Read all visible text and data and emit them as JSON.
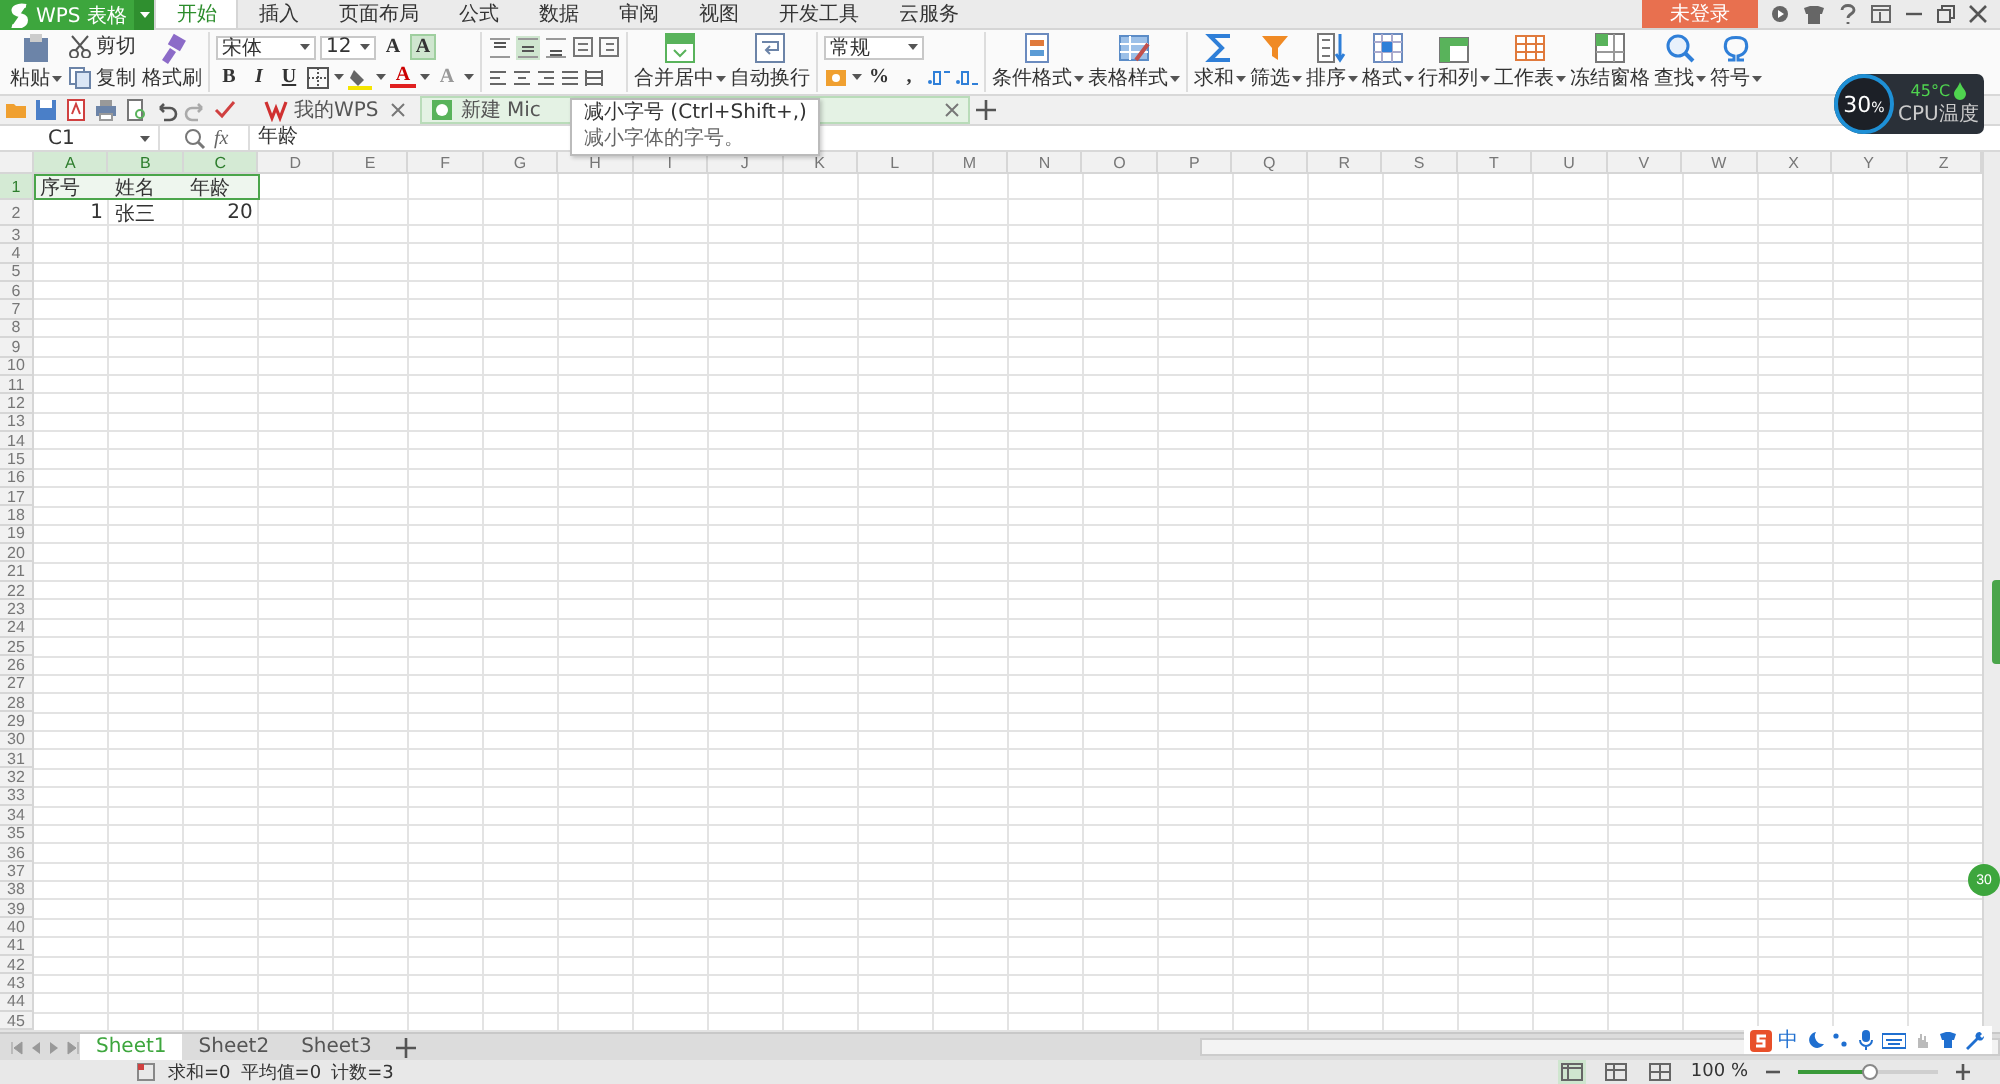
{
  "app_button": {
    "label": "WPS 表格"
  },
  "menu_tabs": [
    {
      "label": "开始",
      "selected": true
    },
    {
      "label": "插入",
      "selected": false
    },
    {
      "label": "页面布局",
      "selected": false
    },
    {
      "label": "公式",
      "selected": false
    },
    {
      "label": "数据",
      "selected": false
    },
    {
      "label": "审阅",
      "selected": false
    },
    {
      "label": "视图",
      "selected": false
    },
    {
      "label": "开发工具",
      "selected": false
    },
    {
      "label": "云服务",
      "selected": false
    }
  ],
  "login_button": "未登录",
  "ribbon": {
    "clipboard": {
      "paste": "粘贴",
      "cut": "剪切",
      "copy": "复制",
      "format_painter": "格式刷"
    },
    "font": {
      "name": "宋体",
      "size": "12",
      "grow": {
        "label": "A",
        "hovered": false
      },
      "shrink": {
        "label": "A",
        "hovered": true
      },
      "bold": "B",
      "italic": "I",
      "underline": "U",
      "font_color": "A",
      "clear": "A"
    },
    "vertical_align": [
      {
        "selected": false
      },
      {
        "selected": true
      },
      {
        "selected": false
      }
    ],
    "merge": "合并居中",
    "wrap": "自动换行",
    "number": {
      "format": "常规",
      "percent": "%",
      "comma": ","
    },
    "tools": [
      {
        "label": "条件格式",
        "dropdown": true,
        "kind": "cond"
      },
      {
        "label": "表格样式",
        "dropdown": true,
        "kind": "style"
      },
      {
        "label": "求和",
        "dropdown": true,
        "kind": "sum"
      },
      {
        "label": "筛选",
        "dropdown": true,
        "kind": "filter"
      },
      {
        "label": "排序",
        "dropdown": true,
        "kind": "sort"
      },
      {
        "label": "格式",
        "dropdown": true,
        "kind": "format"
      },
      {
        "label": "行和列",
        "dropdown": true,
        "kind": "rowcol"
      },
      {
        "label": "工作表",
        "dropdown": true,
        "kind": "sheet"
      },
      {
        "label": "冻结窗格",
        "dropdown": false,
        "kind": "freeze"
      },
      {
        "label": "查找",
        "dropdown": true,
        "kind": "find"
      },
      {
        "label": "符号",
        "dropdown": true,
        "kind": "symbol"
      }
    ]
  },
  "doc_tabs": [
    {
      "label": "我的WPS",
      "selected": false
    },
    {
      "label": "新建 Mic",
      "selected": true
    }
  ],
  "tooltip": {
    "title": "减小字号 (Ctrl+Shift+,)",
    "body": "减小字体的字号。"
  },
  "cpu_widget": {
    "load": "30",
    "unit": "%",
    "temperature": "45°C",
    "caption": "CPU温度"
  },
  "formula_bar": {
    "name_box": "C1",
    "function_label": "fx",
    "value": "年龄"
  },
  "columns": [
    {
      "label": "A",
      "selected": true
    },
    {
      "label": "B",
      "selected": true
    },
    {
      "label": "C",
      "selected": true
    },
    {
      "label": "D",
      "selected": false
    },
    {
      "label": "E",
      "selected": false
    },
    {
      "label": "F",
      "selected": false
    },
    {
      "label": "G",
      "selected": false
    },
    {
      "label": "H",
      "selected": false
    },
    {
      "label": "I",
      "selected": false
    },
    {
      "label": "J",
      "selected": false
    },
    {
      "label": "K",
      "selected": false
    },
    {
      "label": "L",
      "selected": false
    },
    {
      "label": "M",
      "selected": false
    },
    {
      "label": "N",
      "selected": false
    },
    {
      "label": "O",
      "selected": false
    },
    {
      "label": "P",
      "selected": false
    },
    {
      "label": "Q",
      "selected": false
    },
    {
      "label": "R",
      "selected": false
    },
    {
      "label": "S",
      "selected": false
    },
    {
      "label": "T",
      "selected": false
    },
    {
      "label": "U",
      "selected": false
    },
    {
      "label": "V",
      "selected": false
    },
    {
      "label": "W",
      "selected": false
    },
    {
      "label": "X",
      "selected": false
    },
    {
      "label": "Y",
      "selected": false
    },
    {
      "label": "Z",
      "selected": false
    }
  ],
  "rows": [
    {
      "label": "1",
      "selected": true,
      "cells": [
        {
          "text": "序号",
          "kind": "text"
        },
        {
          "text": "姓名",
          "kind": "text"
        },
        {
          "text": "年龄",
          "kind": "text"
        }
      ]
    },
    {
      "label": "2",
      "selected": false,
      "cells": [
        {
          "text": "1",
          "kind": "number"
        },
        {
          "text": "张三",
          "kind": "text"
        },
        {
          "text": "20",
          "kind": "number"
        }
      ]
    },
    {
      "label": "3",
      "selected": false
    },
    {
      "label": "4",
      "selected": false
    },
    {
      "label": "5",
      "selected": false
    },
    {
      "label": "6",
      "selected": false
    },
    {
      "label": "7",
      "selected": false
    },
    {
      "label": "8",
      "selected": false
    },
    {
      "label": "9",
      "selected": false
    },
    {
      "label": "10",
      "selected": false
    },
    {
      "label": "11",
      "selected": false
    },
    {
      "label": "12",
      "selected": false
    },
    {
      "label": "13",
      "selected": false
    },
    {
      "label": "14",
      "selected": false
    },
    {
      "label": "15",
      "selected": false
    },
    {
      "label": "16",
      "selected": false
    },
    {
      "label": "17",
      "selected": false
    },
    {
      "label": "18",
      "selected": false
    },
    {
      "label": "19",
      "selected": false
    },
    {
      "label": "20",
      "selected": false
    },
    {
      "label": "21",
      "selected": false
    },
    {
      "label": "22",
      "selected": false
    },
    {
      "label": "23",
      "selected": false
    },
    {
      "label": "24",
      "selected": false
    },
    {
      "label": "25",
      "selected": false
    },
    {
      "label": "26",
      "selected": false
    },
    {
      "label": "27",
      "selected": false
    },
    {
      "label": "28",
      "selected": false
    },
    {
      "label": "29",
      "selected": false
    },
    {
      "label": "30",
      "selected": false
    },
    {
      "label": "31",
      "selected": false
    },
    {
      "label": "32",
      "selected": false
    },
    {
      "label": "33",
      "selected": false
    },
    {
      "label": "34",
      "selected": false
    },
    {
      "label": "35",
      "selected": false
    },
    {
      "label": "36",
      "selected": false
    },
    {
      "label": "37",
      "selected": false
    },
    {
      "label": "38",
      "selected": false
    },
    {
      "label": "39",
      "selected": false
    },
    {
      "label": "40",
      "selected": false
    },
    {
      "label": "41",
      "selected": false
    },
    {
      "label": "42",
      "selected": false
    },
    {
      "label": "43",
      "selected": false
    },
    {
      "label": "44",
      "selected": false
    },
    {
      "label": "45",
      "selected": false
    }
  ],
  "side_badge": "30",
  "sheet_tabs": [
    {
      "label": "Sheet1",
      "selected": true
    },
    {
      "label": "Sheet2",
      "selected": false
    },
    {
      "label": "Sheet3",
      "selected": false
    }
  ],
  "status_bar": {
    "stats": [
      "求和=0",
      "平均值=0",
      "计数=3"
    ],
    "views": [
      {
        "selected": true
      },
      {
        "selected": false
      },
      {
        "selected": false
      }
    ],
    "zoom": "100 %",
    "zoom_slider": {
      "level": 0.51
    }
  },
  "ime_toolbar": {
    "mode": "中"
  }
}
